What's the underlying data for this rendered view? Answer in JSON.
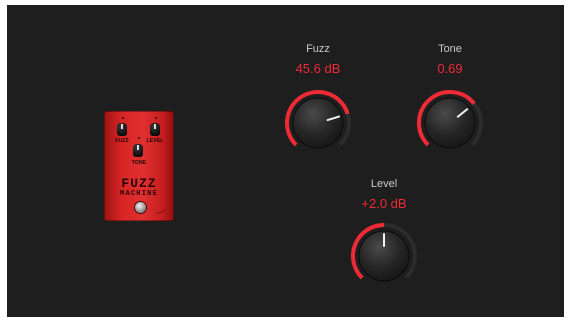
{
  "pedal": {
    "knob_fuzz_label": "FUZZ",
    "knob_level_label": "LEVEL",
    "knob_tone_label": "TONE",
    "brand_line1": "FUZZ",
    "brand_line2": "MACHINE",
    "body_color": "#d72424"
  },
  "controls": {
    "fuzz": {
      "label": "Fuzz",
      "value": "45.6 dB",
      "fraction": 0.77
    },
    "tone": {
      "label": "Tone",
      "value": "0.69",
      "fraction": 0.69
    },
    "level": {
      "label": "Level",
      "value": "+2.0 dB",
      "fraction": 0.5
    }
  },
  "colors": {
    "background": "#1e1e1e",
    "accent": "#ee2a36",
    "track": "#2c2c2c",
    "label": "#c9c9c9"
  }
}
